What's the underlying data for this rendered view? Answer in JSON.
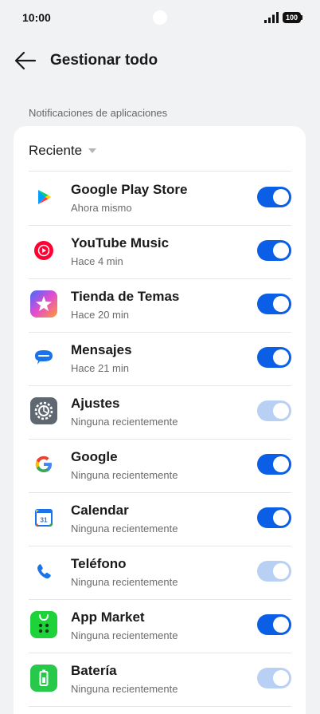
{
  "status": {
    "time": "10:00",
    "battery": "100"
  },
  "header": {
    "title": "Gestionar todo"
  },
  "section": {
    "label": "Notificaciones de aplicaciones"
  },
  "sort": {
    "label": "Reciente"
  },
  "apps": [
    {
      "name": "Google Play Store",
      "time": "Ahora mismo",
      "enabled": true,
      "disabled": false,
      "icon": "play-store-icon"
    },
    {
      "name": "YouTube Music",
      "time": "Hace 4 min",
      "enabled": true,
      "disabled": false,
      "icon": "youtube-music-icon"
    },
    {
      "name": "Tienda de Temas",
      "time": "Hace 20 min",
      "enabled": true,
      "disabled": false,
      "icon": "theme-store-icon"
    },
    {
      "name": "Mensajes",
      "time": "Hace 21 min",
      "enabled": true,
      "disabled": false,
      "icon": "messages-icon"
    },
    {
      "name": "Ajustes",
      "time": "Ninguna recientemente",
      "enabled": true,
      "disabled": true,
      "icon": "settings-icon"
    },
    {
      "name": "Google",
      "time": "Ninguna recientemente",
      "enabled": true,
      "disabled": false,
      "icon": "google-icon"
    },
    {
      "name": "Calendar",
      "time": "Ninguna recientemente",
      "enabled": true,
      "disabled": false,
      "icon": "calendar-icon"
    },
    {
      "name": "Teléfono",
      "time": "Ninguna recientemente",
      "enabled": true,
      "disabled": true,
      "icon": "phone-icon"
    },
    {
      "name": "App Market",
      "time": "Ninguna recientemente",
      "enabled": true,
      "disabled": false,
      "icon": "app-market-icon"
    },
    {
      "name": "Batería",
      "time": "Ninguna recientemente",
      "enabled": true,
      "disabled": true,
      "icon": "battery-app-icon"
    }
  ],
  "colors": {
    "accent": "#0a5fe6",
    "accent_disabled": "#b9d0f5",
    "background": "#f1f2f4"
  }
}
